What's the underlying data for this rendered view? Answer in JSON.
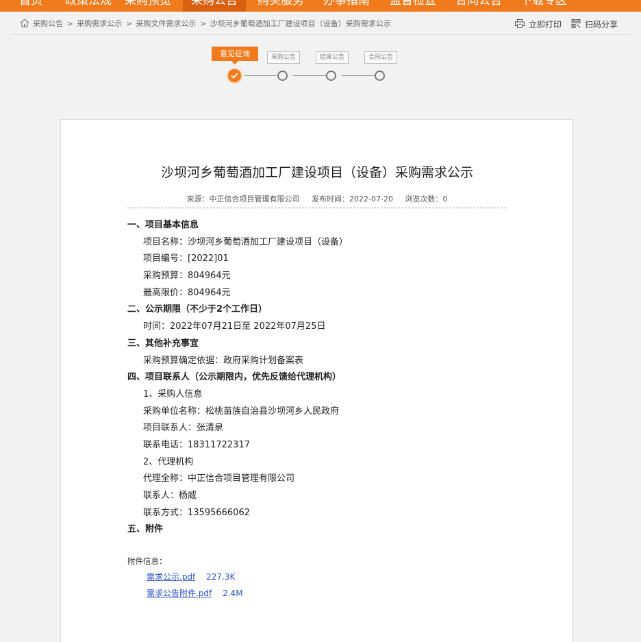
{
  "nav": {
    "items": [
      {
        "label": "首页"
      },
      {
        "label": "政策法规"
      },
      {
        "label": "采购预览"
      },
      {
        "label": "采购公告"
      },
      {
        "label": "购买服务"
      },
      {
        "label": "办事指南"
      },
      {
        "label": "监督检查"
      },
      {
        "label": "合同公告"
      },
      {
        "label": "下载专区"
      }
    ],
    "active_index": 3
  },
  "breadcrumb": {
    "items": [
      "采购公告",
      "采购需求公示",
      "采购文件需求公示",
      "沙坝河乡葡萄酒加工厂建设项目（设备）采购需求公示"
    ],
    "separator": ">"
  },
  "tools": {
    "print": {
      "label": "立即打印",
      "icon": "printer-icon"
    },
    "share": {
      "label": "扫码分享",
      "icon": "qr-code-icon"
    }
  },
  "steps": {
    "items": [
      {
        "label": "意见征询",
        "done": true
      },
      {
        "label": "采购公告",
        "done": false
      },
      {
        "label": "结果公告",
        "done": false
      },
      {
        "label": "合同公告",
        "done": false
      }
    ]
  },
  "article": {
    "title": "沙坝河乡葡萄酒加工厂建设项目（设备）采购需求公示",
    "source": "来源：中正信合项目管理有限公司",
    "publish_time": "发布时间：2022-07-20",
    "views": "浏览次数：0",
    "lines": [
      {
        "text": "一、项目基本信息",
        "heading": true
      },
      {
        "text": "项目名称：沙坝河乡葡萄酒加工厂建设项目（设备）",
        "heading": false
      },
      {
        "text": "项目编号：[2022]01",
        "heading": false
      },
      {
        "text": "采购预算：804964元",
        "heading": false
      },
      {
        "text": "最高限价：804964元",
        "heading": false
      },
      {
        "text": "二、公示期限（不少于2个工作日）",
        "heading": true
      },
      {
        "text": "时间：2022年07月21日至 2022年07月25日",
        "heading": false
      },
      {
        "text": "三、其他补充事宜",
        "heading": true
      },
      {
        "text": "采购预算确定依据：政府采购计划备案表",
        "heading": false
      },
      {
        "text": "四、项目联系人（公示期限内，优先反馈给代理机构）",
        "heading": true
      },
      {
        "text": "1、采购人信息",
        "heading": false
      },
      {
        "text": "采购单位名称：松桃苗族自治县沙坝河乡人民政府",
        "heading": false
      },
      {
        "text": "项目联系人：张清泉",
        "heading": false
      },
      {
        "text": "联系电话：18311722317",
        "heading": false
      },
      {
        "text": "2、代理机构",
        "heading": false
      },
      {
        "text": "代理全称：中正信合项目管理有限公司",
        "heading": false
      },
      {
        "text": "联系人：杨威",
        "heading": false
      },
      {
        "text": "联系方式：13595666062",
        "heading": false
      },
      {
        "text": "五、附件",
        "heading": true
      }
    ]
  },
  "attachments": {
    "label": "附件信息：",
    "files": [
      {
        "name": "需求公示.pdf",
        "size": "227.3K"
      },
      {
        "name": "需求公告附件.pdf",
        "size": "2.4M"
      }
    ]
  },
  "colors": {
    "accent": "#f17b1c",
    "link": "#2a51c9"
  }
}
